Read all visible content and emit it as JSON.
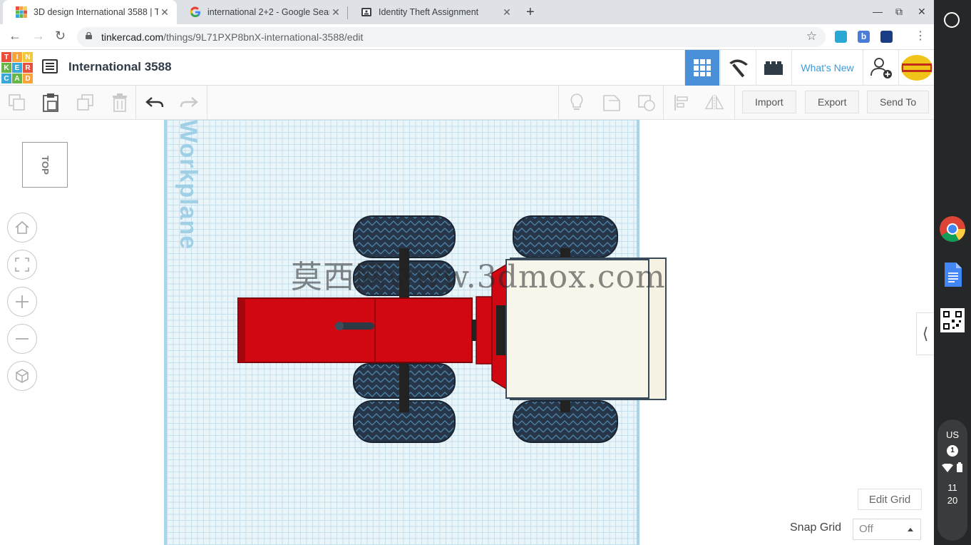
{
  "browser": {
    "tabs": [
      {
        "title": "3D design International 3588 | T",
        "active": true
      },
      {
        "title": "international 2+2 - Google Searc",
        "active": false
      },
      {
        "title": "Identity Theft Assignment",
        "active": false
      }
    ],
    "url_host": "tinkercad.com",
    "url_path": "/things/9L71PXP8bnX-international-3588/edit"
  },
  "header": {
    "logo_letters": [
      "TIN",
      "KER",
      "CAD"
    ],
    "design_title": "International 3588",
    "whats_new": "What's New",
    "accent_color": "#3a9bd9"
  },
  "toolbar": {
    "import_label": "Import",
    "export_label": "Export",
    "send_to_label": "Send To"
  },
  "view": {
    "viewcube_label": "TOP",
    "workplane_label": "Workplane",
    "watermark": "莫西网www.3dmox.com",
    "edit_grid_label": "Edit Grid",
    "snap_grid_label": "Snap Grid",
    "snap_grid_value": "Off"
  },
  "system_tray": {
    "input_method": "US",
    "notification_count": "1",
    "time_hour": "11",
    "time_minute": "20"
  }
}
